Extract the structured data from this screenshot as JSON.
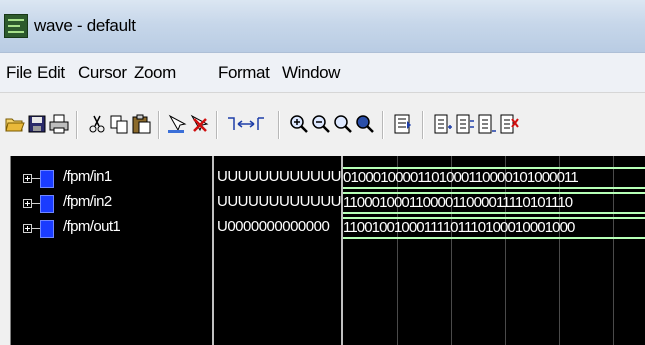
{
  "window": {
    "title": "wave - default"
  },
  "menu": [
    "File",
    "Edit",
    "Cursor",
    "Zoom",
    "Format",
    "Window"
  ],
  "toolbar": {
    "icons": [
      "open-icon",
      "save-icon",
      "print-icon",
      "cut-icon",
      "copy-icon",
      "paste-icon",
      "find-icon",
      "delete-icon",
      "insert-cursor-icon",
      "zoom-in-icon",
      "zoom-out-icon",
      "zoom-area-icon",
      "zoom-full-icon",
      "format-icon",
      "group-1-icon",
      "group-2-icon",
      "group-3-icon",
      "group-4-icon"
    ]
  },
  "signals": [
    {
      "name": "/fpm/in1",
      "value": "UUUUUUUUUUUU",
      "wave": "01000100001101000110000101000011"
    },
    {
      "name": "/fpm/in2",
      "value": "UUUUUUUUUUUU",
      "wave": "11000100011000011000011110101110"
    },
    {
      "name": "/fpm/out1",
      "value": "U0000000000000",
      "wave": "11001001000111101110100010001000"
    }
  ],
  "colors": {
    "wave": "#b7ffb7",
    "signal_icon": "#1a3cff",
    "pane_bg": "#000000"
  }
}
